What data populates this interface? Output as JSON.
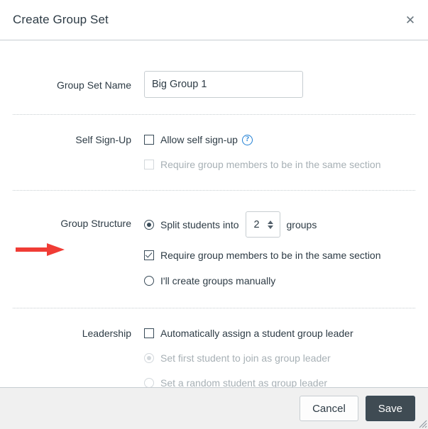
{
  "dialog": {
    "title": "Create Group Set",
    "close_label": "✕"
  },
  "form": {
    "group_set_name": {
      "label": "Group Set Name",
      "value": "Big Group 1",
      "placeholder": ""
    },
    "self_sign_up": {
      "label": "Self Sign-Up",
      "allow_label": "Allow self sign-up",
      "allow_checked": false,
      "help_glyph": "?",
      "same_section_label": "Require group members to be in the same section",
      "same_section_checked": false,
      "same_section_disabled": true
    },
    "group_structure": {
      "label": "Group Structure",
      "split_prefix": "Split students into",
      "split_suffix": "groups",
      "split_selected": true,
      "groups_count": "2",
      "spinner_up": "increment-groups",
      "spinner_down": "decrement-groups",
      "same_section_label": "Require group members to be in the same section",
      "same_section_checked": true,
      "manual_label": "I'll create groups manually",
      "manual_selected": false
    },
    "leadership": {
      "label": "Leadership",
      "auto_assign_label": "Automatically assign a student group leader",
      "auto_assign_checked": false,
      "first_student_label": "Set first student to join as group leader",
      "first_student_selected": true,
      "first_student_disabled": true,
      "random_student_label": "Set a random student as group leader",
      "random_student_selected": false,
      "random_student_disabled": true
    }
  },
  "footer": {
    "cancel_label": "Cancel",
    "save_label": "Save"
  },
  "annotation": {
    "arrow_color": "#f03c35",
    "points_to": "Group Structure"
  },
  "colors": {
    "accent_link": "#1f7fd4",
    "text": "#2d3b45",
    "disabled_text": "#a7b0b5",
    "border": "#c7cdd1",
    "footer_bg": "#f0f0f0",
    "save_bg": "#3f4b53"
  }
}
